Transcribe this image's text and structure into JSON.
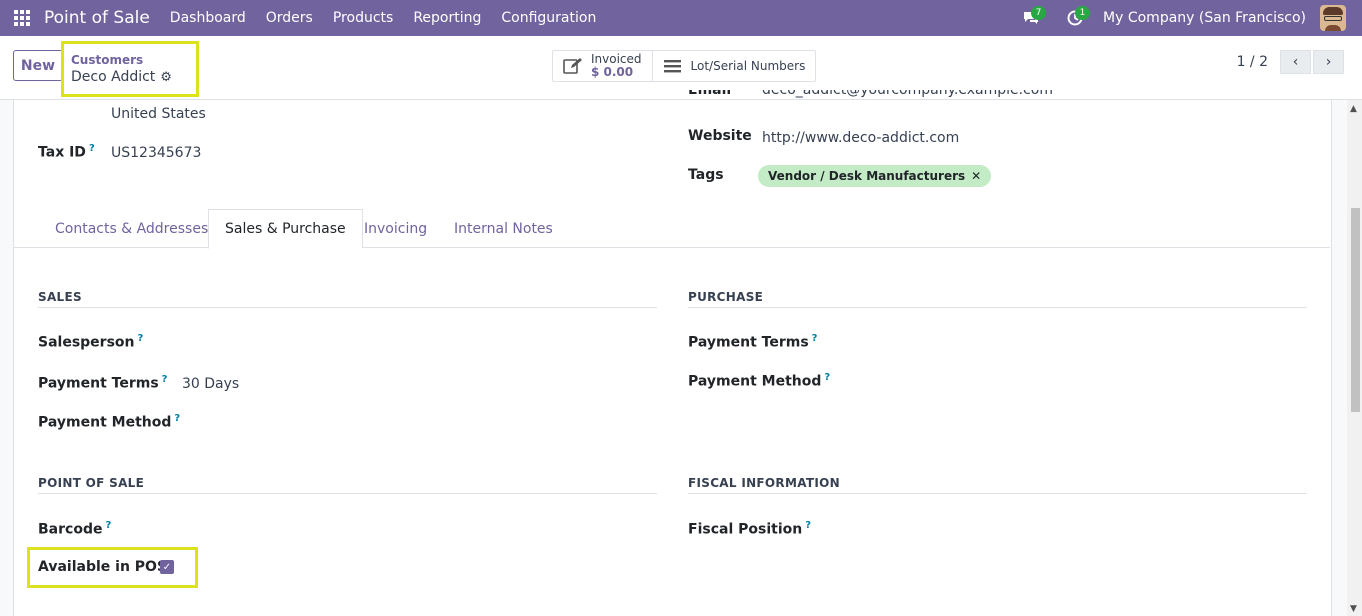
{
  "topbar": {
    "app_name": "Point of Sale",
    "menu": [
      "Dashboard",
      "Orders",
      "Products",
      "Reporting",
      "Configuration"
    ],
    "messages_count": "7",
    "activities_count": "1",
    "company": "My Company (San Francisco)"
  },
  "control": {
    "new_label": "New",
    "breadcrumb_parent": "Customers",
    "breadcrumb_current": "Deco Addict",
    "invoiced_label": "Invoiced",
    "invoiced_value": "$ 0.00",
    "lot_label": "Lot/Serial Numbers",
    "pager": "1 / 2"
  },
  "partner": {
    "country": "United States",
    "tax_id_label": "Tax ID",
    "tax_id": "US12345673",
    "email_label": "Email",
    "email": "deco_addict@yourcompany.example.com",
    "website_label": "Website",
    "website": "http://www.deco-addict.com",
    "tags_label": "Tags",
    "tag": "Vendor / Desk Manufacturers"
  },
  "tabs": [
    "Contacts & Addresses",
    "Sales & Purchase",
    "Invoicing",
    "Internal Notes"
  ],
  "sales": {
    "title": "SALES",
    "salesperson_label": "Salesperson",
    "payment_terms_label": "Payment Terms",
    "payment_terms_value": "30 Days",
    "payment_method_label": "Payment Method"
  },
  "purchase": {
    "title": "PURCHASE",
    "payment_terms_label": "Payment Terms",
    "payment_method_label": "Payment Method"
  },
  "pos": {
    "title": "POINT OF SALE",
    "barcode_label": "Barcode",
    "available_label": "Available in POS",
    "available_checked": true
  },
  "fiscal": {
    "title": "FISCAL INFORMATION",
    "position_label": "Fiscal Position"
  },
  "colors": {
    "brand": "#71639e",
    "highlight": "#dde21e",
    "tag_bg": "#c3ebc6"
  }
}
